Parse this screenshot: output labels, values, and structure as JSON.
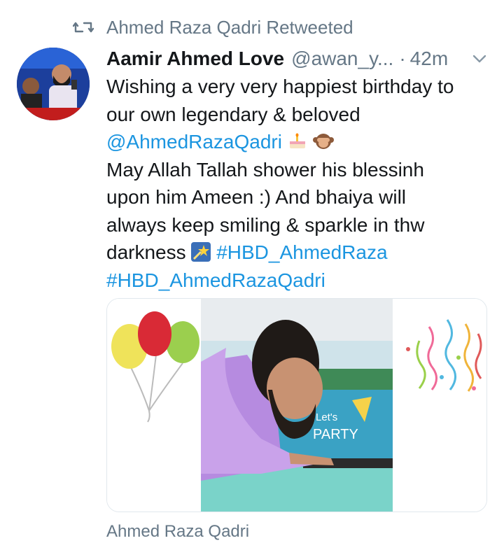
{
  "retweet": {
    "icon": "retweet-icon",
    "text": "Ahmed Raza Qadri Retweeted"
  },
  "tweet": {
    "author_name": "Aamir Ahmed Love",
    "author_handle": "@awan_y...",
    "separator": "·",
    "time": "42m",
    "caret_icon": "chevron-down-icon",
    "lines": [
      {
        "text": "Wishing a very very happiest birthday to"
      },
      {
        "text": "our own legendary & beloved"
      },
      {
        "mention": "@AhmedRazaQadri",
        "emojis": [
          "cake-emoji",
          "see-no-evil-monkey-emoji"
        ]
      },
      {
        "text": "May Allah Tallah shower his blessinh"
      },
      {
        "text": "upon him Ameen :) And bhaiya will"
      },
      {
        "text": "always keep smiling & sparkle in thw"
      },
      {
        "text": "darkness",
        "emoji": "shooting-star-emoji",
        "hashtag": "#HBD_AhmedRaza"
      },
      {
        "hashtag": "#HBD_AhmedRazaQadri"
      }
    ],
    "image_text": {
      "line1": "Let's",
      "line2": "PARTY"
    }
  },
  "footer": {
    "text": "Ahmed Raza Qadri"
  },
  "colors": {
    "link": "#1b95e0",
    "secondary": "#657786",
    "text": "#14171a",
    "border": "#e1e8ed"
  }
}
